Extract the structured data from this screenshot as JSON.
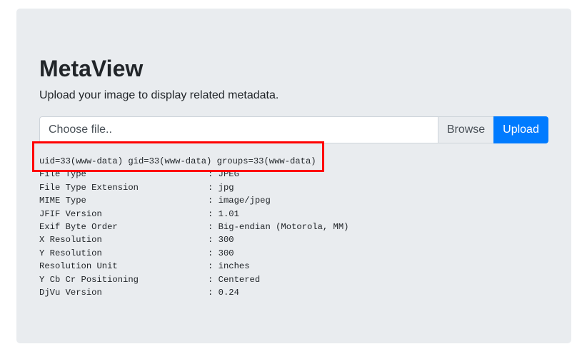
{
  "app": {
    "title": "MetaView",
    "subtitle": "Upload your image to display related metadata."
  },
  "upload_form": {
    "file_placeholder": "Choose file..",
    "browse_label": "Browse",
    "upload_label": "Upload"
  },
  "output": {
    "command_line": "uid=33(www-data) gid=33(www-data) groups=33(www-data)",
    "separator": ": ",
    "metadata": [
      {
        "key": "File Type",
        "value": "JPEG"
      },
      {
        "key": "File Type Extension",
        "value": "jpg"
      },
      {
        "key": "MIME Type",
        "value": "image/jpeg"
      },
      {
        "key": "JFIF Version",
        "value": "1.01"
      },
      {
        "key": "Exif Byte Order",
        "value": "Big-endian (Motorola, MM)"
      },
      {
        "key": "X Resolution",
        "value": "300"
      },
      {
        "key": "Y Resolution",
        "value": "300"
      },
      {
        "key": "Resolution Unit",
        "value": "inches"
      },
      {
        "key": "Y Cb Cr Positioning",
        "value": "Centered"
      },
      {
        "key": "DjVu Version",
        "value": "0.24"
      }
    ]
  },
  "colors": {
    "jumbotron_bg": "#e9ecef",
    "primary": "#007bff",
    "highlight": "#ff0000"
  }
}
